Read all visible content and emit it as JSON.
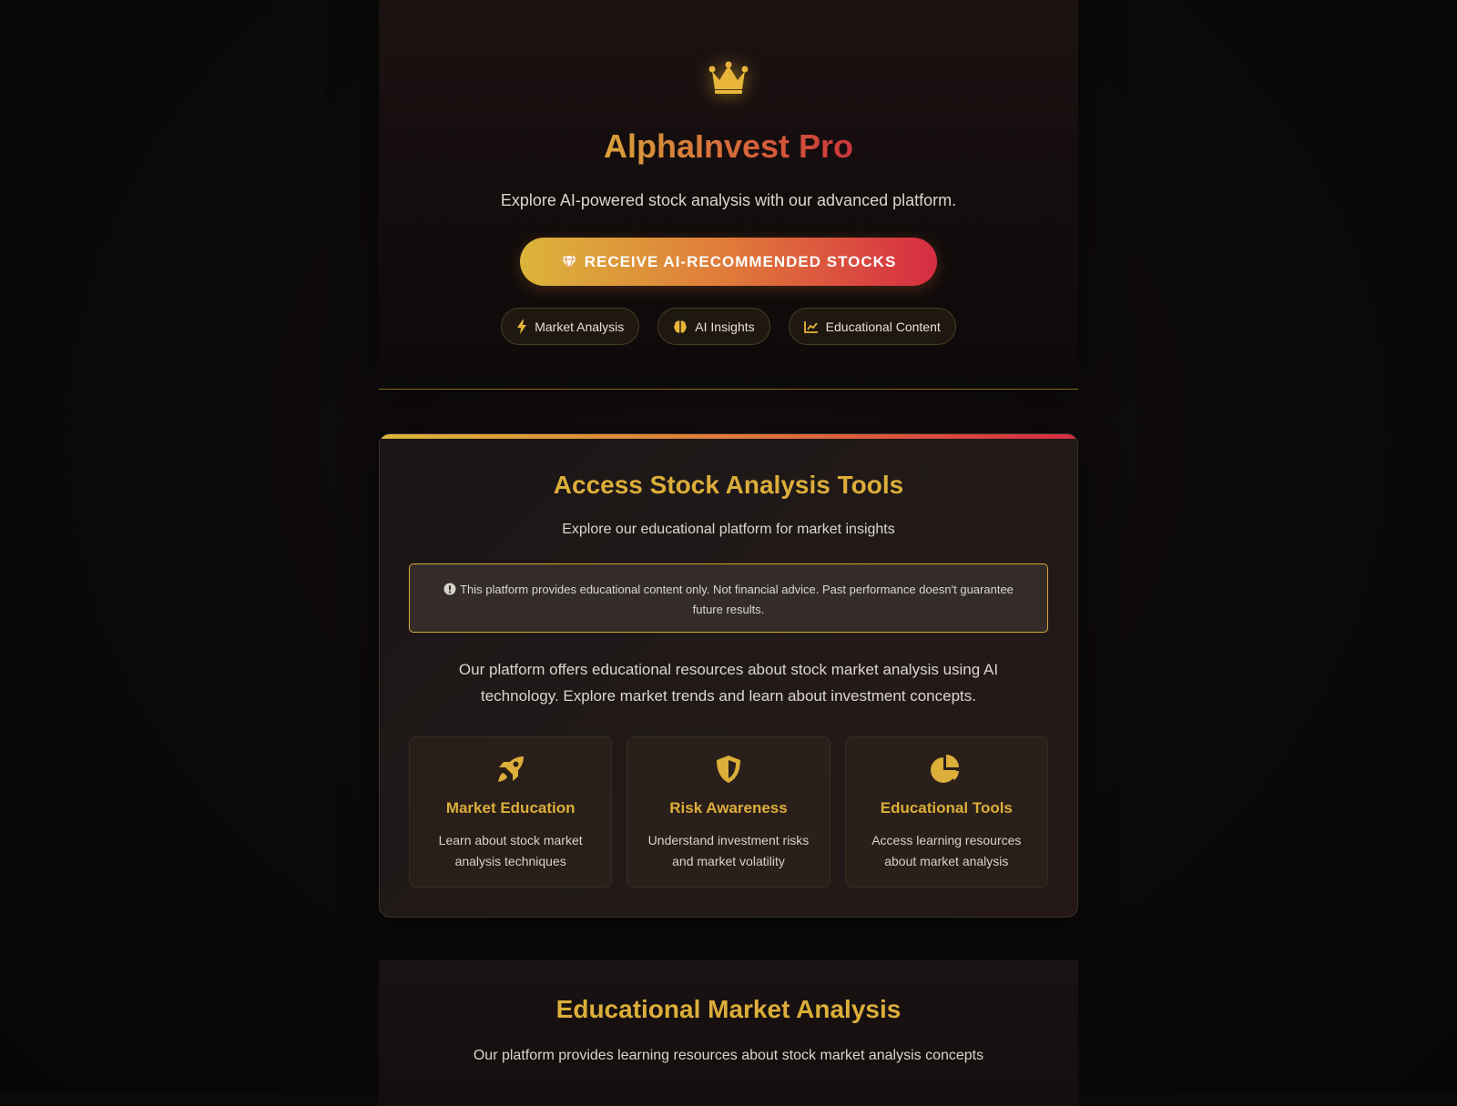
{
  "hero": {
    "logo_icon": "crown-icon",
    "brand": "AlphaInvest Pro",
    "tagline": "Explore AI-powered stock analysis with our advanced platform.",
    "cta_label": "RECEIVE AI-RECOMMENDED STOCKS",
    "cta_icon": "gem-icon",
    "pills": [
      {
        "label": "Market Analysis",
        "icon": "bolt-icon"
      },
      {
        "label": "AI Insights",
        "icon": "brain-icon"
      },
      {
        "label": "Educational Content",
        "icon": "chart-line-icon"
      }
    ]
  },
  "card": {
    "title": "Access Stock Analysis Tools",
    "subtitle": "Explore our educational platform for market insights",
    "warning_icon": "exclamation-circle-icon",
    "warning": "This platform provides educational content only. Not financial advice. Past performance doesn't guarantee future results.",
    "description": "Our platform offers educational resources about stock market analysis using AI technology. Explore market trends and learn about investment concepts.",
    "features": [
      {
        "icon": "rocket-icon",
        "title": "Market Education",
        "desc": "Learn about stock market analysis techniques"
      },
      {
        "icon": "shield-icon",
        "title": "Risk Awareness",
        "desc": "Understand investment risks and market volatility"
      },
      {
        "icon": "chart-pie-icon",
        "title": "Educational Tools",
        "desc": "Access learning resources about market analysis"
      }
    ]
  },
  "edu": {
    "title": "Educational Market Analysis",
    "subtitle": "Our platform provides learning resources about stock market analysis concepts"
  },
  "colors": {
    "accent_gold": "#dcae3a",
    "accent_orange": "#e07a3a",
    "accent_red": "#d62c42",
    "background": "#0c0909"
  }
}
